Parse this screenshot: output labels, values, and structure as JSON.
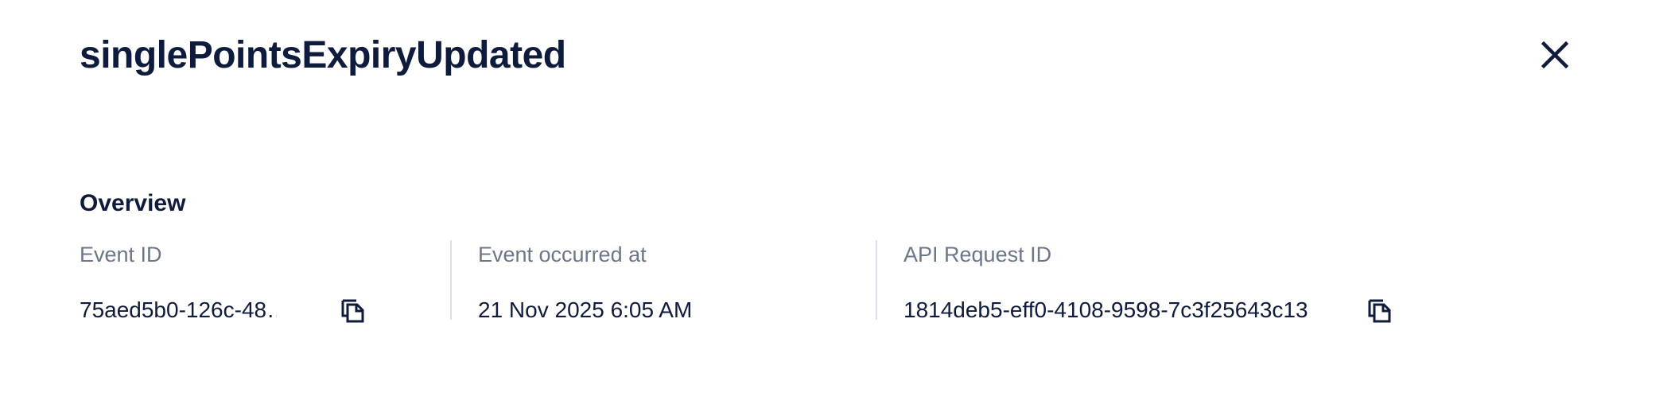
{
  "header": {
    "title": "singlePointsExpiryUpdated",
    "close_icon": "close-icon"
  },
  "overview": {
    "section_title": "Overview",
    "fields": [
      {
        "label": "Event ID",
        "value": "75aed5b0-126c-48…",
        "icon": "copy-icon"
      },
      {
        "label": "Event occurred at",
        "value": "21 Nov 2025 6:05 AM"
      },
      {
        "label": "API Request ID",
        "value": "1814deb5-eff0-4108-9598-7c3f25643c13",
        "icon": "copy-icon"
      }
    ]
  },
  "colors": {
    "text_primary": "#0f1b3d",
    "text_secondary": "#6b7689",
    "divider": "#dde1e7",
    "background": "#ffffff"
  }
}
